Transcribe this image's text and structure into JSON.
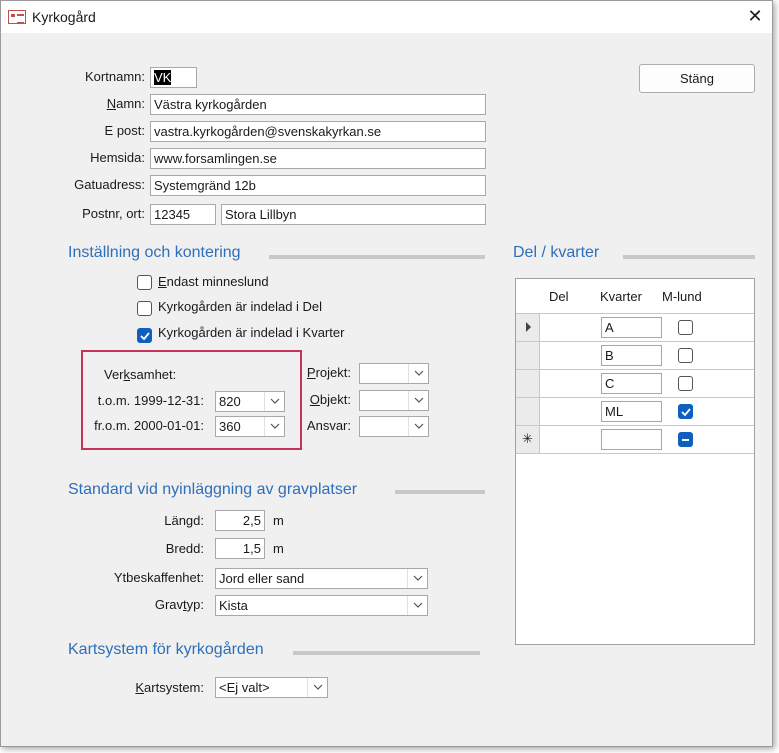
{
  "window": {
    "title": "Kyrkogård"
  },
  "buttons": {
    "close_label": "Stäng"
  },
  "fields": {
    "kortnamn": {
      "label": "Kortnamn:",
      "value": "VK"
    },
    "namn": {
      "label_pre": "",
      "label_ul": "N",
      "label_post": "amn:",
      "value": "Västra kyrkogården"
    },
    "epost": {
      "label": "E post:",
      "value": "vastra.kyrkogården@svenskakyrkan.se"
    },
    "hemsida": {
      "label": "Hemsida:",
      "value": "www.forsamlingen.se"
    },
    "gatuadress": {
      "label": "Gatuadress:",
      "value": "Systemgränd 12b"
    },
    "postnr": {
      "label": "Postnr, ort:",
      "postnr": "12345",
      "ort": "Stora Lillbyn"
    }
  },
  "sections": {
    "installning": "Inställning och kontering",
    "del_kvarter": "Del / kvarter",
    "standard": "Standard vid nyinläggning av gravplatser",
    "kartsystem": "Kartsystem för kyrkogården"
  },
  "checkboxes": {
    "minneslund": {
      "label_ul": "E",
      "label_rest": "ndast minneslund",
      "checked": false
    },
    "indelad_del": {
      "label": "Kyrkogården är indelad i Del",
      "checked": false
    },
    "indelad_kvarter": {
      "label": "Kyrkogården är indelad i Kvarter",
      "checked": true
    }
  },
  "verksamhet": {
    "label_pre": "Ver",
    "label_ul": "k",
    "label_post": "samhet:",
    "rows": [
      {
        "label": "t.o.m. 1999-12-31:",
        "value": "820"
      },
      {
        "label": "fr.o.m. 2000-01-01:",
        "value": "360"
      }
    ]
  },
  "kontering": {
    "projekt": {
      "label_ul": "P",
      "label_rest": "rojekt:",
      "value": ""
    },
    "objekt": {
      "label_ul": "O",
      "label_rest": "bjekt:",
      "value": ""
    },
    "ansvar": {
      "label": "Ansvar:",
      "value": ""
    }
  },
  "grid": {
    "columns": [
      "Del",
      "Kvarter",
      "M-lund"
    ],
    "rows": [
      {
        "kvarter": "A",
        "mlund": false,
        "current": true
      },
      {
        "kvarter": "B",
        "mlund": false,
        "current": false
      },
      {
        "kvarter": "C",
        "mlund": false,
        "current": false
      },
      {
        "kvarter": "ML",
        "mlund": true,
        "current": false
      }
    ],
    "new_row_marker": "✳"
  },
  "standard": {
    "langd": {
      "label": "Längd:",
      "value": "2,5",
      "unit": "m"
    },
    "bredd": {
      "label": "Bredd:",
      "value": "1,5",
      "unit": "m"
    },
    "ytbeskaffenhet": {
      "label": "Ytbeskaffenhet:",
      "value": "Jord eller sand"
    },
    "gravtyp": {
      "label_pre": "Grav",
      "label_ul": "t",
      "label_post": "yp:",
      "value": "Kista"
    }
  },
  "kartsystem": {
    "label_ul": "K",
    "label_rest": "artsystem:",
    "value": "<Ej valt>"
  },
  "colors": {
    "accent": "#2f6eba",
    "highlight_border": "#c8325a",
    "checkbox_on": "#0f5fc0"
  }
}
